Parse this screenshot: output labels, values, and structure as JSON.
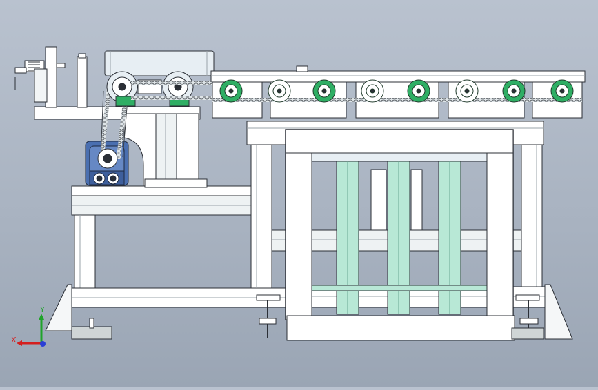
{
  "viewport": {
    "background_top": "#b9c2cf",
    "background_bottom": "#9aa5b4"
  },
  "colors": {
    "frame_white": "#ffffff",
    "frame_outline": "#2b2f36",
    "guide_green": "#b8e8d6",
    "sprocket_green": "#2fae64",
    "motor_blue": "#4a6fb0",
    "roller_pale": "#e7eef3",
    "foot_gray": "#cfd5d6"
  },
  "triad": {
    "x_label": "X",
    "y_label": "Y",
    "x_color": "#d41e1e",
    "y_color": "#1fa32a",
    "z_color": "#2a3fd6"
  },
  "model": {
    "sprocket_count": 8,
    "vertical_guides": 3
  }
}
